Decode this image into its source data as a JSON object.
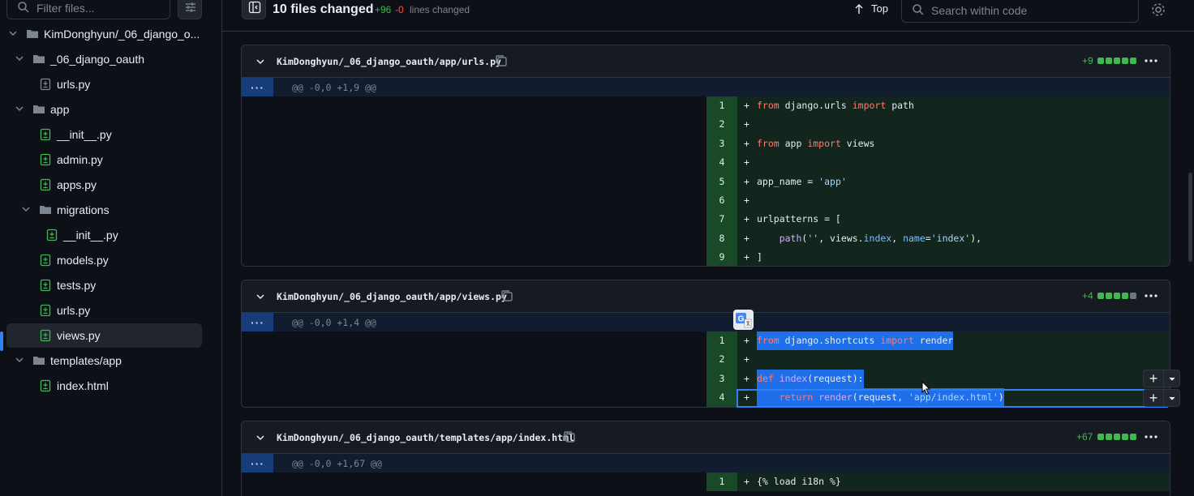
{
  "sidebar": {
    "filter_placeholder": "Filter files...",
    "tree": [
      {
        "label": "KimDonghyun/_06_django_o...",
        "type": "folder",
        "expanded": true,
        "depth": 0
      },
      {
        "label": "_06_django_oauth",
        "type": "folder",
        "expanded": true,
        "depth": 1
      },
      {
        "label": "urls.py",
        "type": "file-modified",
        "depth": 2
      },
      {
        "label": "app",
        "type": "folder",
        "expanded": true,
        "depth": 1
      },
      {
        "label": "__init__.py",
        "type": "file-added",
        "depth": 2
      },
      {
        "label": "admin.py",
        "type": "file-added",
        "depth": 2
      },
      {
        "label": "apps.py",
        "type": "file-added",
        "depth": 2
      },
      {
        "label": "migrations",
        "type": "folder",
        "expanded": true,
        "depth": 2
      },
      {
        "label": "__init__.py",
        "type": "file-added",
        "depth": 3
      },
      {
        "label": "models.py",
        "type": "file-added",
        "depth": 2
      },
      {
        "label": "tests.py",
        "type": "file-added",
        "depth": 2
      },
      {
        "label": "urls.py",
        "type": "file-added",
        "depth": 2
      },
      {
        "label": "views.py",
        "type": "file-added",
        "depth": 2,
        "selected": true
      },
      {
        "label": "templates/app",
        "type": "folder",
        "expanded": true,
        "depth": 1
      },
      {
        "label": "index.html",
        "type": "file-added",
        "depth": 2
      }
    ]
  },
  "topbar": {
    "files_changed": "10 files changed",
    "additions": "+96",
    "deletions": "-0",
    "lines_changed": "lines changed",
    "top_label": "Top",
    "search_placeholder": "Search within code"
  },
  "files": [
    {
      "path": "KimDonghyun/_06_django_oauth/app/urls.py",
      "stat": "+9",
      "blocks": [
        "green",
        "green",
        "green",
        "green",
        "green"
      ],
      "hunk": "@@ -0,0 +1,9 @@",
      "lines": [
        {
          "n": "1",
          "plus": "+",
          "code": "from django.urls import path"
        },
        {
          "n": "2",
          "plus": "+",
          "code": ""
        },
        {
          "n": "3",
          "plus": "+",
          "code": "from app import views"
        },
        {
          "n": "4",
          "plus": "+",
          "code": ""
        },
        {
          "n": "5",
          "plus": "+",
          "code": "app_name = 'app'"
        },
        {
          "n": "6",
          "plus": "+",
          "code": ""
        },
        {
          "n": "7",
          "plus": "+",
          "code": "urlpatterns = ["
        },
        {
          "n": "8",
          "plus": "+",
          "code": "    path('', views.index, name='index'),"
        },
        {
          "n": "9",
          "plus": "+",
          "code": "]"
        }
      ]
    },
    {
      "path": "KimDonghyun/_06_django_oauth/app/views.py",
      "stat": "+4",
      "blocks": [
        "green",
        "green",
        "green",
        "green",
        "gray"
      ],
      "hunk": "@@ -0,0 +1,4 @@",
      "lines": [
        {
          "n": "1",
          "plus": "+",
          "code": "from django.shortcuts import render"
        },
        {
          "n": "2",
          "plus": "+",
          "code": ""
        },
        {
          "n": "3",
          "plus": "+",
          "code": "def index(request):"
        },
        {
          "n": "4",
          "plus": "+",
          "code": "    return render(request, 'app/index.html')"
        }
      ]
    },
    {
      "path": "KimDonghyun/_06_django_oauth/templates/app/index.html",
      "stat": "+67",
      "blocks": [
        "green",
        "green",
        "green",
        "green",
        "green"
      ],
      "hunk": "@@ -0,0 +1,67 @@",
      "lines": [
        {
          "n": "1",
          "plus": "+",
          "code": "{% load i18n %}"
        }
      ]
    }
  ],
  "colors": {
    "background": "#0d1117",
    "added_line": "#2ea043",
    "selection": "#1f6feb",
    "keyword": "#ff7b72",
    "string": "#a5d6ff",
    "function": "#d2a8ff"
  },
  "icons": [
    "search-icon",
    "sliders-icon",
    "sidebar-toggle-icon",
    "arrow-up-icon",
    "gear-icon",
    "chevron-down-icon",
    "folder-icon",
    "file-diff-icon",
    "copy-icon",
    "kebab-icon",
    "translate-icon",
    "plus-icon",
    "caret-down-icon",
    "cursor-icon"
  ]
}
